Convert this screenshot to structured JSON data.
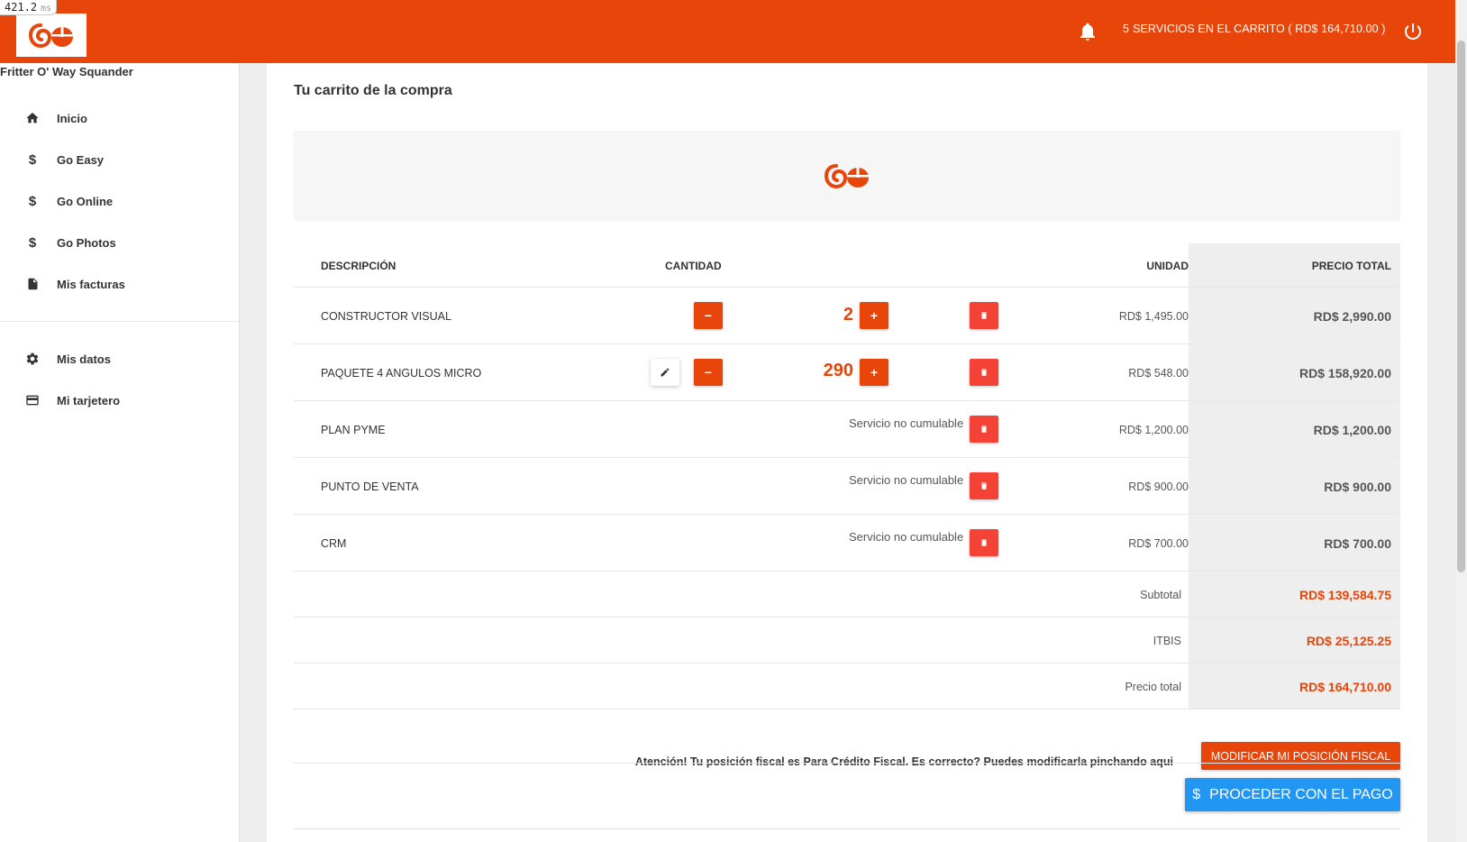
{
  "colors": {
    "brand": "#e8450a",
    "danger": "#f44336",
    "primary": "#2196f3"
  },
  "timing": {
    "value": "421.2",
    "unit": "ms"
  },
  "header": {
    "logo_icon": "go-logo-icon",
    "cart_count": "5",
    "cart_text": "SERVICIOS EN EL CARRITO ( RD$ 164,710.00 )"
  },
  "sidebar": {
    "user_name": "Fritter O' Way Squander",
    "items": [
      {
        "label": "Inicio",
        "icon": "home-icon"
      },
      {
        "label": "Go Easy",
        "icon": "dollar-icon"
      },
      {
        "label": "Go Online",
        "icon": "dollar-icon"
      },
      {
        "label": "Go Photos",
        "icon": "dollar-icon"
      },
      {
        "label": "Mis facturas",
        "icon": "document-icon"
      },
      {
        "label": "Mis datos",
        "icon": "gear-icon"
      },
      {
        "label": "Mi tarjetero",
        "icon": "credit-card-icon"
      }
    ]
  },
  "main": {
    "title": "Tu carrito de la compra",
    "columns": {
      "description": "DESCRIPCIÓN",
      "quantity": "CANTIDAD",
      "unit": "UNIDAD",
      "total": "PRECIO TOTAL"
    },
    "rows": [
      {
        "description": "CONSTRUCTOR VISUAL",
        "quantity": "2",
        "unit_price": "RD$ 1,495.00",
        "total": "RD$ 2,990.00"
      },
      {
        "description": "PAQUETE 4 ANGULOS MICRO",
        "quantity": "290",
        "unit_price": "RD$ 548.00",
        "total": "RD$ 158,920.00"
      },
      {
        "description": "PLAN PYME",
        "note": "Servicio no cumulable",
        "unit_price": "RD$ 1,200.00",
        "total": "RD$ 1,200.00"
      },
      {
        "description": "PUNTO DE VENTA",
        "note": "Servicio no cumulable",
        "unit_price": "RD$ 900.00",
        "total": "RD$ 900.00"
      },
      {
        "description": "CRM",
        "note": "Servicio no cumulable",
        "unit_price": "RD$ 700.00",
        "total": "RD$ 700.00"
      }
    ],
    "summary": {
      "subtotal_label": "Subtotal",
      "subtotal": "RD$ 139,584.75",
      "tax_label": "ITBIS",
      "tax": "RD$ 25,125.25",
      "total_label": "Precio total",
      "total": "RD$ 164,710.00"
    },
    "fiscal_note": "Atención! Tu posición fiscal es Para Crédito Fiscal. Es correcto? Puedes modificarla pinchando aqui",
    "fiscal_button": "MODIFICAR MI POSICIÓN FISCAL",
    "pay_button": "PROCEDER CON EL PAGO",
    "pay_symbol": "$",
    "minus_symbol": "−",
    "plus_symbol": "+"
  }
}
